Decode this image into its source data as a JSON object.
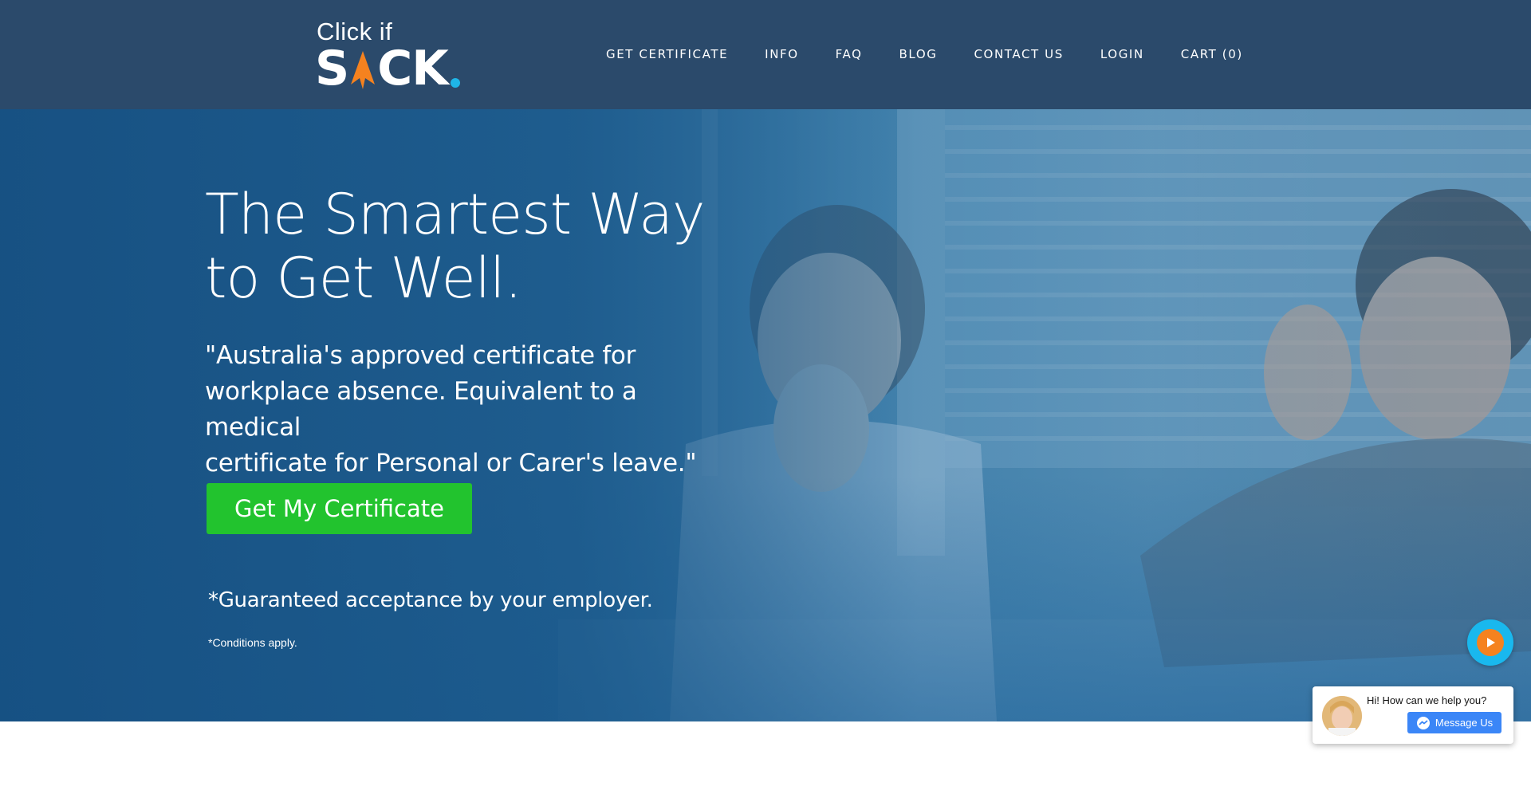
{
  "brand": {
    "top_text": "Click if",
    "main_left": "S",
    "main_right": "CK",
    "colors": {
      "arrow": "#f5821f",
      "dot": "#1fb6e8"
    }
  },
  "nav": {
    "items": [
      {
        "label": "GET CERTIFICATE"
      },
      {
        "label": "INFO"
      },
      {
        "label": "FAQ"
      },
      {
        "label": "BLOG"
      },
      {
        "label": "CONTACT US"
      },
      {
        "label": "LOGIN"
      },
      {
        "label": "CART (0)"
      }
    ]
  },
  "hero": {
    "title_line1": "The Smartest Way",
    "title_line2": "to Get Well.",
    "quote_line1": "\"Australia's approved certificate for",
    "quote_line2": "workplace absence. Equivalent to a medical",
    "quote_line3": "certificate for Personal or Carer's leave.\"",
    "cta_label": "Get My Certificate",
    "guarantee": "*Guaranteed acceptance by your employer.",
    "conditions": "*Conditions apply."
  },
  "video_button": {
    "icon": "play-icon"
  },
  "chat": {
    "greeting": "Hi! How can we help you?",
    "button_label": "Message Us",
    "icon": "messenger-icon"
  },
  "colors": {
    "header_bg": "#2b4a6b",
    "cta_bg": "#22c32e",
    "video_outer": "#19b8ee",
    "video_inner": "#f5821f",
    "chat_button": "#3b86f7"
  }
}
